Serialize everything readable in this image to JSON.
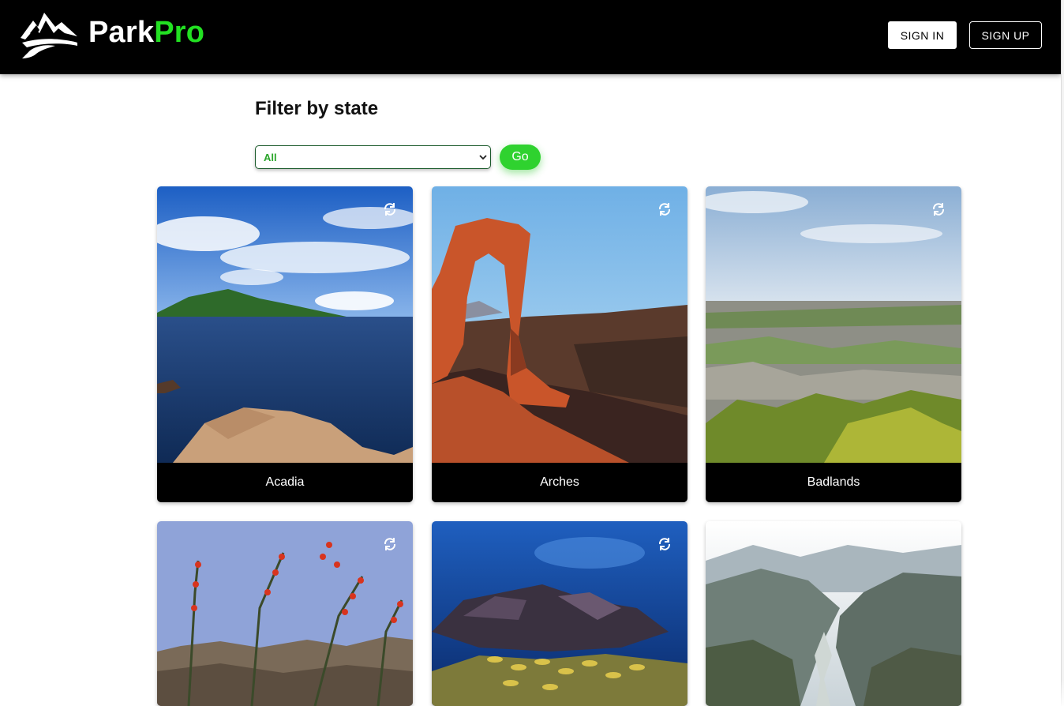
{
  "brand": {
    "name_primary": "Park",
    "name_accent": "Pro",
    "accent_color": "#22e022",
    "logo_icon": "mountain-logo-icon"
  },
  "nav": {
    "signin_label": "SIGN IN",
    "signup_label": "SIGN UP"
  },
  "filter": {
    "title": "Filter by state",
    "selected": "All",
    "go_label": "Go",
    "go_color": "#2fd22f"
  },
  "parks": [
    {
      "name": "Acadia",
      "icon": "refresh-icon"
    },
    {
      "name": "Arches",
      "icon": "refresh-icon"
    },
    {
      "name": "Badlands",
      "icon": "refresh-icon"
    },
    {
      "name": "",
      "icon": "refresh-icon"
    },
    {
      "name": "",
      "icon": "refresh-icon"
    },
    {
      "name": "",
      "icon": "refresh-icon"
    }
  ]
}
